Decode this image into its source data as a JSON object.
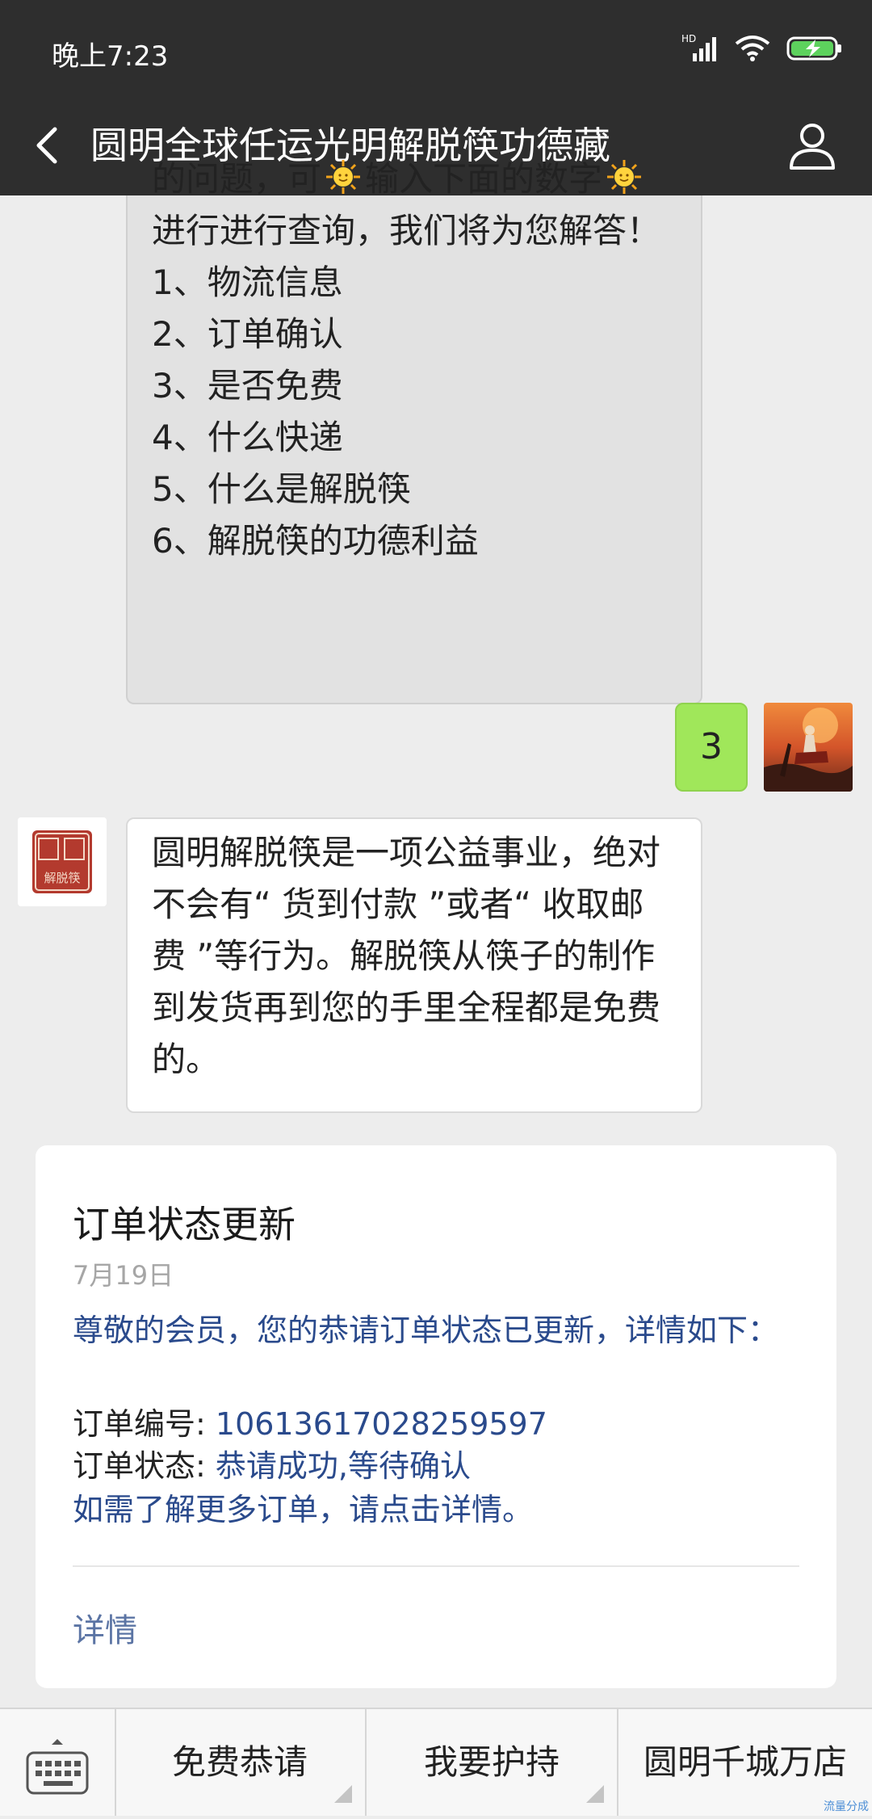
{
  "status_bar": {
    "time": "晚上7:23",
    "network_label": "HD"
  },
  "header": {
    "title": "圆明全球任运光明解脱筷功德藏"
  },
  "messages": {
    "bot_menu": {
      "line1_a": "的问题，可",
      "line1_b": "输入下面的数字",
      "line2": "进行进行查询，我们将为您解答！",
      "items": [
        "1、物流信息",
        "2、订单确认",
        "3、是否免费",
        "4、什么快递",
        "5、什么是解脱筷",
        "6、解脱筷的功德利益"
      ]
    },
    "user_reply": {
      "text": "3"
    },
    "bot_answer": {
      "avatar_text_top": "圆明",
      "avatar_text_bottom": "解脱筷",
      "lines": [
        "圆明解脱筷是一项公益事业，绝对",
        "不会有“ 货到付款 ”或者“ 收取邮",
        "费 ”等行为。解脱筷从筷子的制作",
        "到发货再到您的手里全程都是免费",
        "的。"
      ]
    }
  },
  "card": {
    "title": "订单状态更新",
    "date": "7月19日",
    "greeting": "尊敬的会员，您的恭请订单状态已更新，详情如下：",
    "order_no_label": "订单编号: ",
    "order_no_value": "10613617028259597",
    "order_status_label": "订单状态: ",
    "order_status_value": "恭请成功,等待确认",
    "note": "如需了解更多订单，请点击详情。",
    "details_link": "详情"
  },
  "menu_bar": {
    "items": [
      "免费恭请",
      "我要护持",
      "圆明千城万店"
    ]
  },
  "watermark": "流量分成"
}
